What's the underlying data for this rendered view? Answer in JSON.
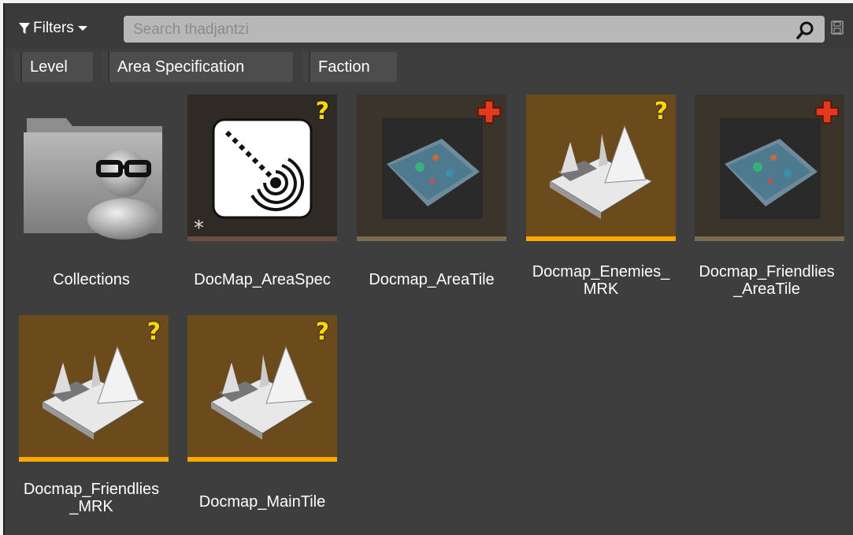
{
  "toolbar": {
    "filters_label": "Filters",
    "search_placeholder": "Search thadjantzi"
  },
  "chips": [
    "Level",
    "Area Specification",
    "Faction"
  ],
  "tiles": [
    {
      "label": "Collections",
      "kind": "folder-icon"
    },
    {
      "label": "DocMap_AreaSpec",
      "kind": "area-spec-icon",
      "badge": "?"
    },
    {
      "label": "Docmap_AreaTile",
      "kind": "area-tile-thumbnail",
      "badge": "+"
    },
    {
      "label": "Docmap_Enemies_\nMRK",
      "kind": "marker-thumbnail",
      "badge": "?"
    },
    {
      "label": "Docmap_Friendlies\n_AreaTile",
      "kind": "area-tile-thumbnail",
      "badge": "+"
    },
    {
      "label": "Docmap_Friendlies\n_MRK",
      "kind": "marker-thumbnail",
      "badge": "?"
    },
    {
      "label": "Docmap_MainTile",
      "kind": "marker-thumbnail",
      "badge": "?"
    }
  ],
  "colors": {
    "panel_bg": "#3e3e3e",
    "search_bg": "#b8b8b8",
    "marker_tile_bg": "#6b4b1c",
    "marker_bar": "#ffa800",
    "tile_dark_bg": "#2f2a26",
    "tile_bar_gray": "#7a6c52",
    "areaspec_bar": "#6a4e44",
    "badge_yellow": "#ffd800",
    "badge_red": "#e23a1a"
  }
}
